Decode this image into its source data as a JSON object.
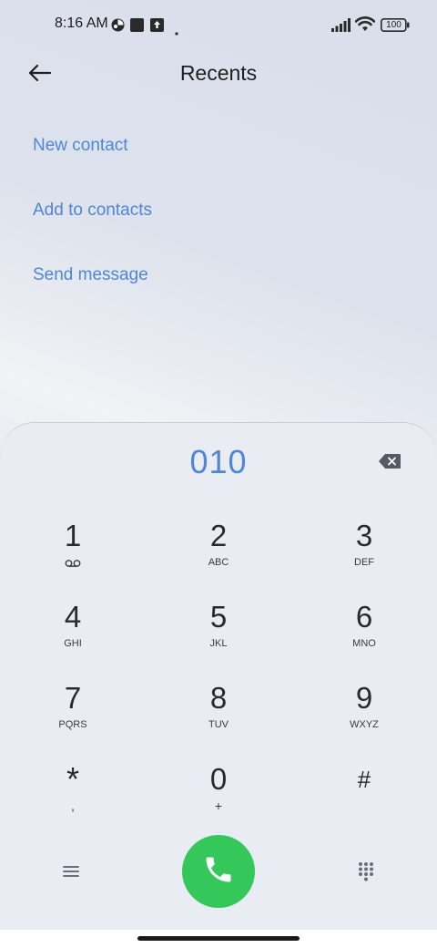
{
  "status_bar": {
    "time": "8:16 AM",
    "battery": "100",
    "icons": [
      "circle-app-icon",
      "square-app-icon",
      "upload-icon",
      "dot-icon",
      "signal-icon",
      "wifi-icon",
      "battery-icon"
    ]
  },
  "header": {
    "title": "Recents",
    "back_icon": "arrow-left-icon"
  },
  "actions": [
    {
      "label": "New contact"
    },
    {
      "label": "Add to contacts"
    },
    {
      "label": "Send message"
    }
  ],
  "dialer": {
    "number": "010",
    "backspace_icon": "backspace-icon",
    "keys": [
      {
        "digit": "1",
        "letters": ""
      },
      {
        "digit": "2",
        "letters": "ABC"
      },
      {
        "digit": "3",
        "letters": "DEF"
      },
      {
        "digit": "4",
        "letters": "GHI"
      },
      {
        "digit": "5",
        "letters": "JKL"
      },
      {
        "digit": "6",
        "letters": "MNO"
      },
      {
        "digit": "7",
        "letters": "PQRS"
      },
      {
        "digit": "8",
        "letters": "TUV"
      },
      {
        "digit": "9",
        "letters": "WXYZ"
      },
      {
        "digit": "*",
        "letters": ","
      },
      {
        "digit": "0",
        "letters": "+"
      },
      {
        "digit": "#",
        "letters": ""
      }
    ],
    "voicemail_icon": "voicemail-icon",
    "menu_icon": "hamburger-icon",
    "call_icon": "phone-icon",
    "keypad_icon": "keypad-grid-icon"
  },
  "colors": {
    "accent": "#4f86d6",
    "call_button": "#34c759"
  }
}
